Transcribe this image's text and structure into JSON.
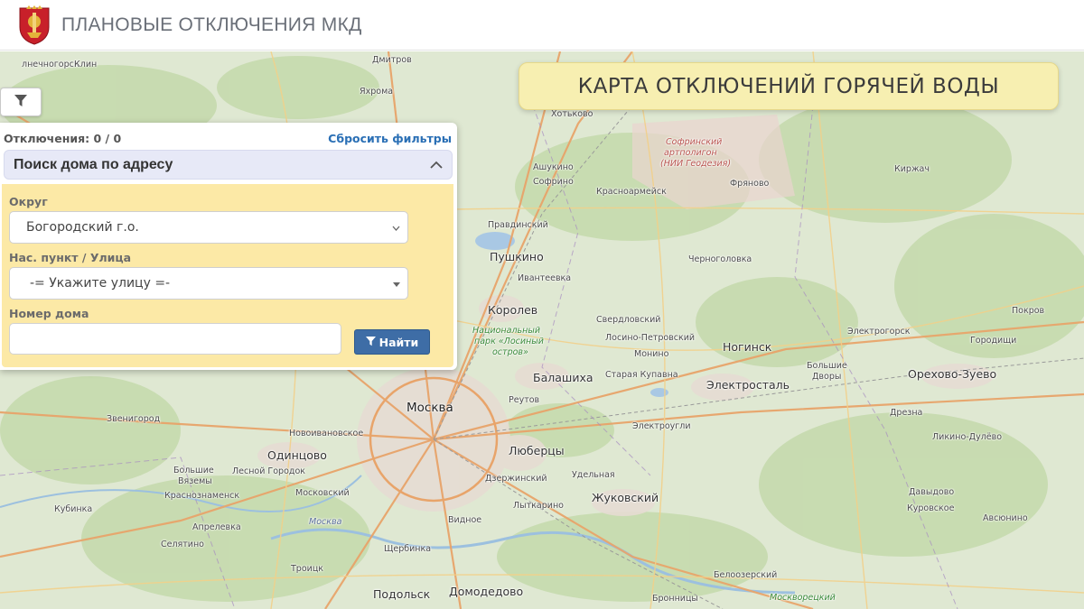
{
  "header": {
    "title": "ПЛАНОВЫЕ ОТКЛЮЧЕНИЯ МКД",
    "logo_icon": "moscow-oblast-coat-of-arms"
  },
  "map": {
    "heading": "КАРТА ОТКЛЮЧЕНИЙ ГОРЯЧЕЙ ВОДЫ",
    "places": {
      "dmitrov": "Дмитров",
      "klin": "Клин",
      "solnechnogorsk": "лнечногорск",
      "yakhroma": "Яхрома",
      "khotkovo": "Хотьково",
      "sofrinsky": "Софринский",
      "artpoligon": "артполигон",
      "niigeodezia": "(НИИ Геодезия)",
      "ashukino": "Ашукино",
      "sofrino": "Софрино",
      "krasnoarmeysk": "Красноармейск",
      "fryanovo": "Фряново",
      "kirzhach": "Киржач",
      "pravdinsky": "Правдинский",
      "pushkino": "Пушкино",
      "chernogolovka": "Черноголовка",
      "ivanteevka": "Ивантеевка",
      "korolev": "Королев",
      "sverdlovsky": "Свердловский",
      "pokrov": "Покров",
      "natpark1": "Национальный",
      "natpark2": "парк «Лосиный",
      "natpark3": "остров»",
      "losino": "Лосино-Петровский",
      "monino": "Монино",
      "noginsk": "Ногинск",
      "elektrogorsk": "Электрогорск",
      "gorodishchi": "Городищи",
      "bolshie": "Большие",
      "dvory": "Дворы",
      "orekhovo": "Орехово-Зуево",
      "balashikha": "Балашиха",
      "staraya": "Старая Купавна",
      "elektrostal": "Электросталь",
      "moskva": "Москва",
      "reutov": "Реутов",
      "zvenigorod": "Звенигород",
      "elektrougli": "Электроугли",
      "drezna": "Дрезна",
      "novoivanovskoe": "Новоивановское",
      "likino": "Ликино-Дулёво",
      "odintsovo": "Одинцово",
      "lyubertsy": "Люберцы",
      "bolshie_vyazemy1": "Большие",
      "bolshie_vyazemy2": "Вяземы",
      "lesnoy": "Лесной Городок",
      "dzerzhinsky": "Дзержинский",
      "udelnaya": "Удельная",
      "krasnoznamensk": "Краснознаменск",
      "moskovsky": "Московский",
      "zhukovsky": "Жуковский",
      "davydovo": "Давыдово",
      "kubinka": "Кубинка",
      "lytkarino": "Лыткарино",
      "kurovskoe": "Куровское",
      "avsyunino": "Авсюнино",
      "moskva_region": "Москва",
      "aprelevka": "Апрелевка",
      "vidnoe": "Видное",
      "selyatino": "Селятино",
      "shcherbinka": "Щербинка",
      "troitsk": "Троицк",
      "beloozersky": "Белоозерский",
      "podolsk": "Подольск",
      "domodedovo": "Домодедово",
      "bronnitsy": "Бронницы",
      "moskvoretsky": "Москворецкий"
    }
  },
  "panel": {
    "counter_label": "Отключения: 0 / 0",
    "reset_label": "Сбросить фильтры",
    "section_title": "Поиск дома по адресу",
    "okrug_label": "Округ",
    "okrug_value": "Богородский г.о.",
    "street_label": "Нас. пункт / Улица",
    "street_value": "-= Укажите улицу =-",
    "house_label": "Номер дома",
    "house_value": "",
    "find_label": "Найти"
  },
  "colors": {
    "accent": "#3e6da6",
    "form_bg": "#fce9a6",
    "heading_bg": "#f7efb1",
    "map_bg": "#dfe8d2"
  }
}
